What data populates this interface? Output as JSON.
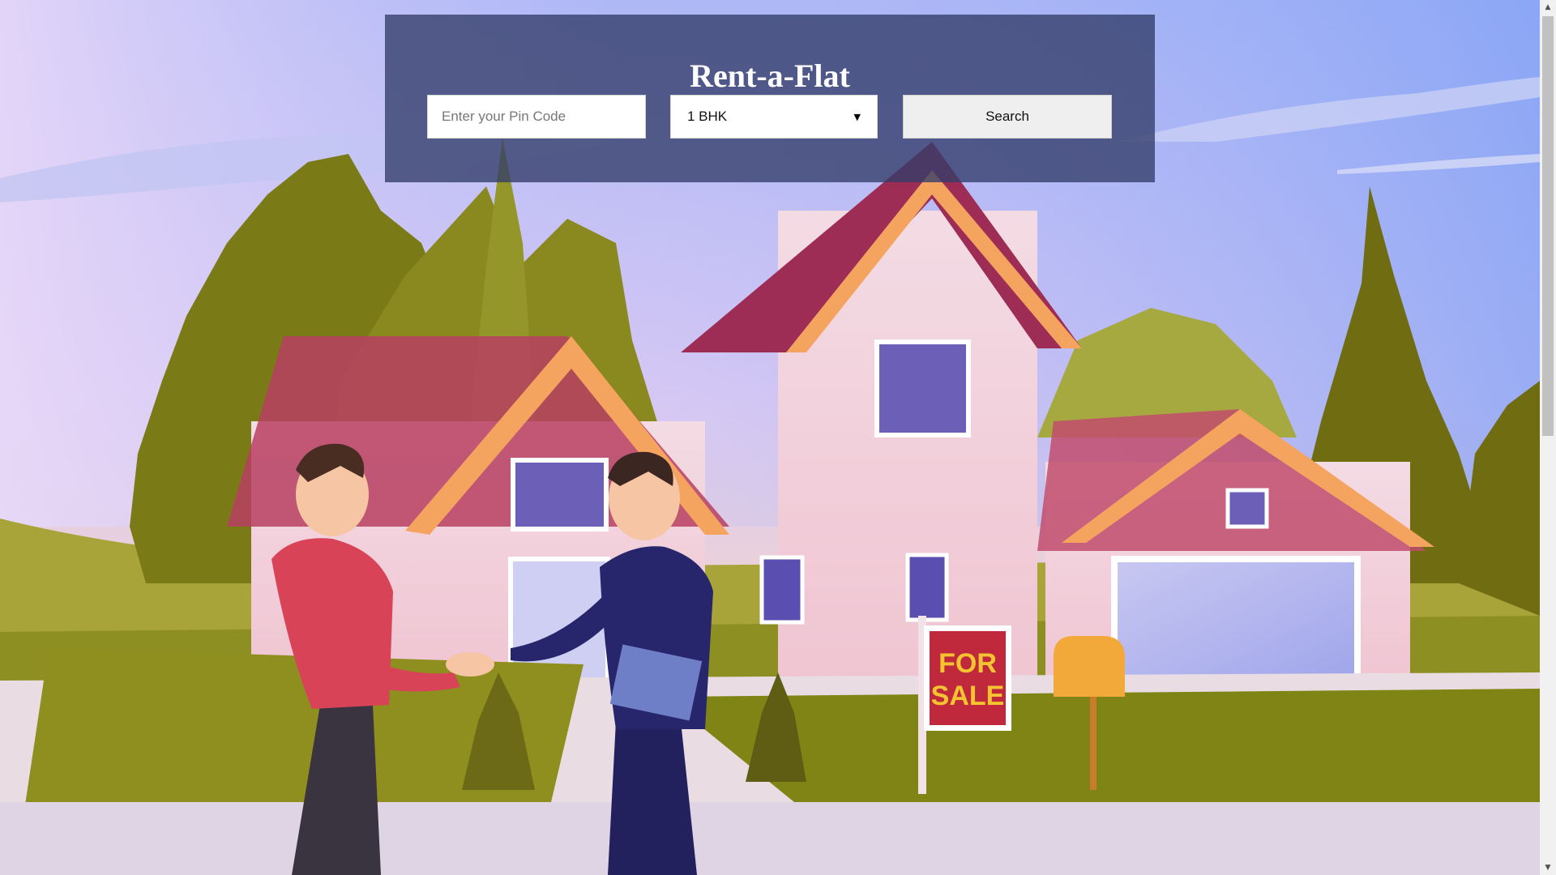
{
  "header": {
    "title": "Rent-a-Flat"
  },
  "search": {
    "pin_placeholder": "Enter your Pin Code",
    "pin_value": "",
    "bhk_selected": "1 BHK",
    "search_label": "Search"
  },
  "scene": {
    "sign_line1": "FOR",
    "sign_line2": "SALE"
  },
  "colors": {
    "panel": "#323c69",
    "sign_red": "#c0283c",
    "sign_text": "#f4c430",
    "sky_top": "#9fb4f5"
  }
}
